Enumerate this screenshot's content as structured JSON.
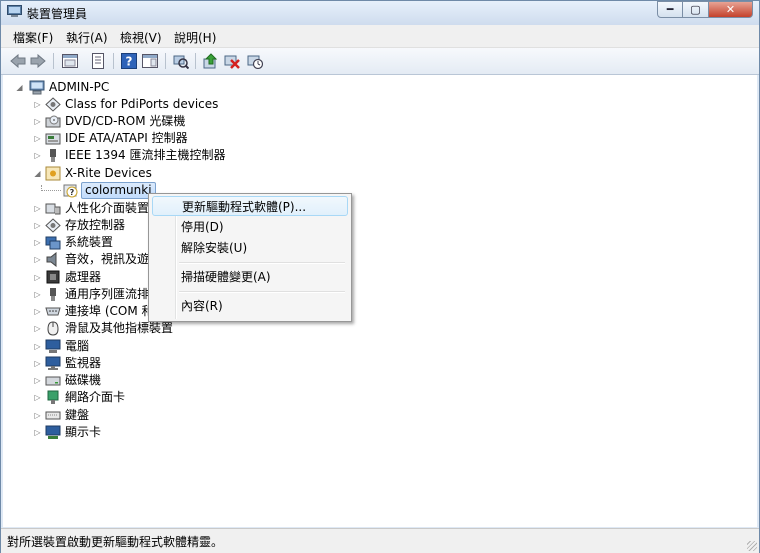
{
  "window": {
    "title": "裝置管理員",
    "controls": {
      "minimize": "━",
      "maximize": "▢",
      "close": "✕"
    }
  },
  "menu": [
    "檔案(F)",
    "執行(A)",
    "檢視(V)",
    "說明(H)"
  ],
  "toolbar": [
    "back-arrow-icon",
    "forward-arrow-icon",
    "show-hide-tree-icon",
    "properties-icon",
    "help-icon",
    "action-pane-icon",
    "scan-hardware-icon",
    "update-driver-icon",
    "uninstall-icon",
    "disable-icon"
  ],
  "tree": {
    "root": "ADMIN-PC",
    "items": [
      {
        "label": "Class for PdiPorts devices",
        "icon": "port-class-icon"
      },
      {
        "label": "DVD/CD-ROM 光碟機",
        "icon": "dvd-drive-icon"
      },
      {
        "label": "IDE ATA/ATAPI 控制器",
        "icon": "ide-controller-icon"
      },
      {
        "label": "IEEE 1394 匯流排主機控制器",
        "icon": "ieee1394-icon"
      },
      {
        "label": "X-Rite Devices",
        "icon": "xrite-device-icon",
        "expanded": true,
        "children": [
          {
            "label": "colormunki",
            "icon": "unknown-device-icon",
            "selected": true
          }
        ]
      },
      {
        "label": "人性化介面裝置",
        "icon": "hid-icon"
      },
      {
        "label": "存放控制器",
        "icon": "storage-controller-icon"
      },
      {
        "label": "系統裝置",
        "icon": "system-device-icon"
      },
      {
        "label": "音效，視訊及遊",
        "icon": "sound-icon"
      },
      {
        "label": "處理器",
        "icon": "processor-icon"
      },
      {
        "label": "通用序列匯流排",
        "icon": "usb-icon"
      },
      {
        "label": "連接埠 (COM 和",
        "icon": "com-port-icon"
      },
      {
        "label": "滑鼠及其他指標裝置",
        "icon": "mouse-icon"
      },
      {
        "label": "電腦",
        "icon": "computer-icon"
      },
      {
        "label": "監視器",
        "icon": "monitor-icon"
      },
      {
        "label": "磁碟機",
        "icon": "disk-drive-icon"
      },
      {
        "label": "網路介面卡",
        "icon": "network-adapter-icon"
      },
      {
        "label": "鍵盤",
        "icon": "keyboard-icon"
      },
      {
        "label": "顯示卡",
        "icon": "display-adapter-icon"
      }
    ]
  },
  "context_menu": {
    "items": [
      {
        "label": "更新驅動程式軟體(P)...",
        "highlighted": true
      },
      {
        "label": "停用(D)"
      },
      {
        "label": "解除安裝(U)"
      },
      {
        "separator": true
      },
      {
        "label": "掃描硬體變更(A)"
      },
      {
        "separator": true
      },
      {
        "label": "內容(R)"
      }
    ]
  },
  "status": {
    "text": "對所選裝置啟動更新驅動程式軟體精靈。"
  }
}
